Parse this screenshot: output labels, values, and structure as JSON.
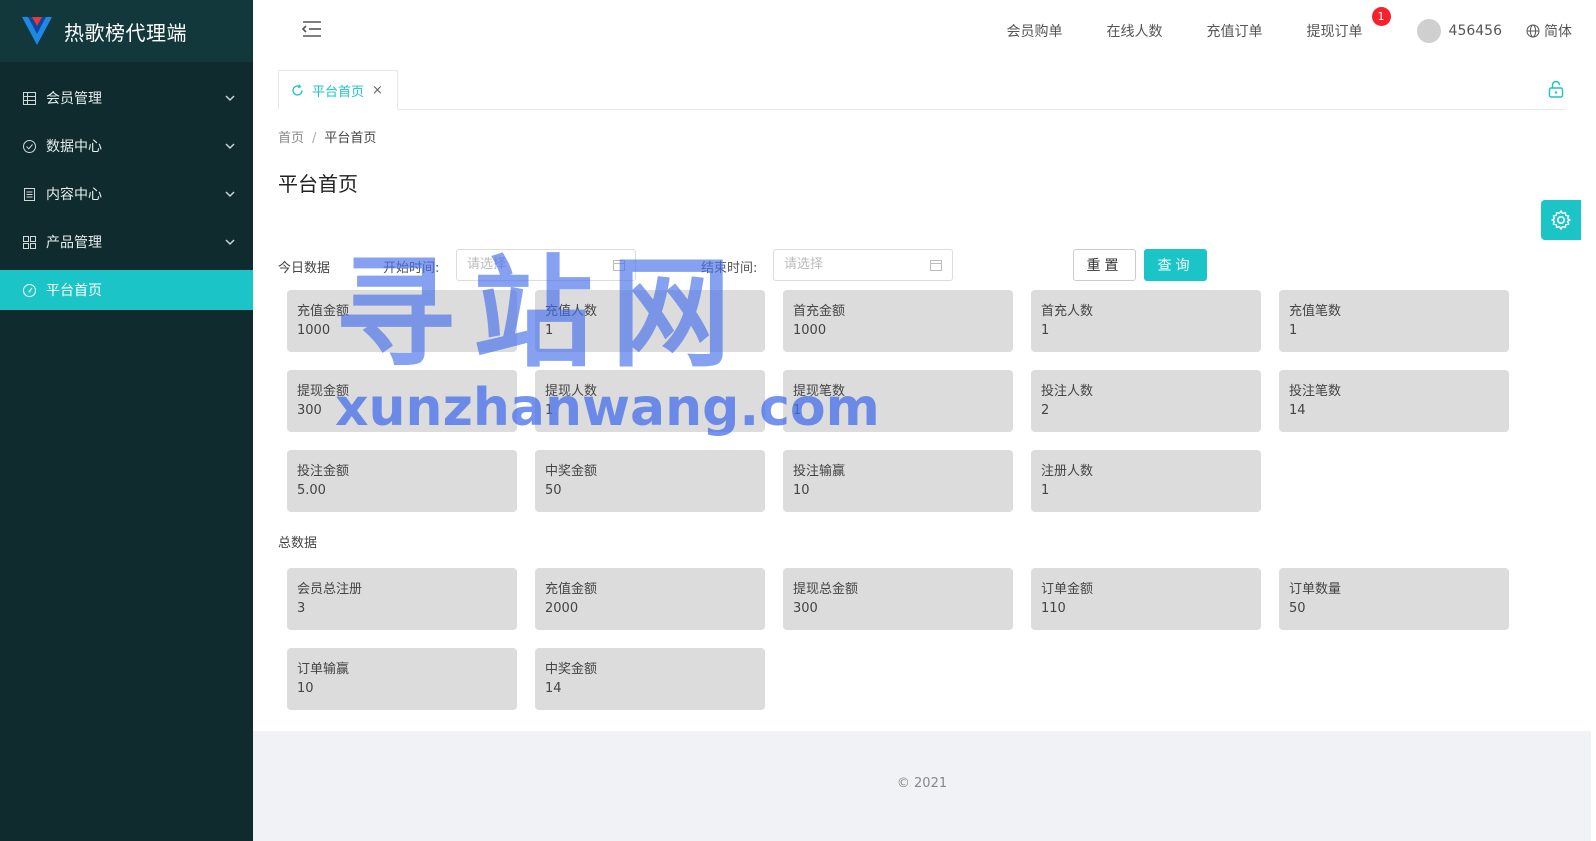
{
  "app": {
    "title": "热歌榜代理端"
  },
  "sidebar": {
    "items": [
      {
        "label": "会员管理",
        "icon": "table-icon"
      },
      {
        "label": "数据中心",
        "icon": "check-circle-icon"
      },
      {
        "label": "内容中心",
        "icon": "document-icon"
      },
      {
        "label": "产品管理",
        "icon": "grid-icon"
      },
      {
        "label": "平台首页",
        "icon": "dashboard-icon",
        "active": true
      }
    ]
  },
  "header": {
    "nav": [
      "会员购单",
      "在线人数",
      "充值订单",
      "提现订单"
    ],
    "badge_count": "1",
    "username": "456456",
    "language": "简体"
  },
  "tabs": {
    "current": "平台首页",
    "close": "×"
  },
  "breadcrumb": {
    "home": "首页",
    "sep": "/",
    "current": "平台首页"
  },
  "page": {
    "title": "平台首页"
  },
  "filter": {
    "today_label": "今日数据",
    "start_label": "开始时间:",
    "start_placeholder": "请选择",
    "end_label": "结束时间:",
    "end_placeholder": "请选择",
    "reset": "重置",
    "query": "查询"
  },
  "today_stats": [
    {
      "label": "充值金额",
      "value": "1000"
    },
    {
      "label": "充值人数",
      "value": "1"
    },
    {
      "label": "首充金额",
      "value": "1000"
    },
    {
      "label": "首充人数",
      "value": "1"
    },
    {
      "label": "充值笔数",
      "value": "1"
    },
    {
      "label": "提现金额",
      "value": "300"
    },
    {
      "label": "提现人数",
      "value": "1"
    },
    {
      "label": "提现笔数",
      "value": "1"
    },
    {
      "label": "投注人数",
      "value": "2"
    },
    {
      "label": "投注笔数",
      "value": "14"
    },
    {
      "label": "投注金额",
      "value": "5.00"
    },
    {
      "label": "中奖金额",
      "value": "50"
    },
    {
      "label": "投注输赢",
      "value": "10"
    },
    {
      "label": "注册人数",
      "value": "1"
    }
  ],
  "total_label": "总数据",
  "total_stats": [
    {
      "label": "会员总注册",
      "value": "3"
    },
    {
      "label": "充值金额",
      "value": "2000"
    },
    {
      "label": "提现总金额",
      "value": "300"
    },
    {
      "label": "订单金额",
      "value": "110"
    },
    {
      "label": "订单数量",
      "value": "50"
    },
    {
      "label": "订单输赢",
      "value": "10"
    },
    {
      "label": "中奖金额",
      "value": "14"
    }
  ],
  "footer": {
    "copyright": "© 2021"
  },
  "watermark": {
    "big": "寻站网",
    "small": "xunzhanwang.com"
  },
  "colors": {
    "accent": "#1bc4c7",
    "sidebar_bg": "#0f2b2e",
    "card_bg": "#dcdcdc",
    "badge": "#f5222d"
  }
}
